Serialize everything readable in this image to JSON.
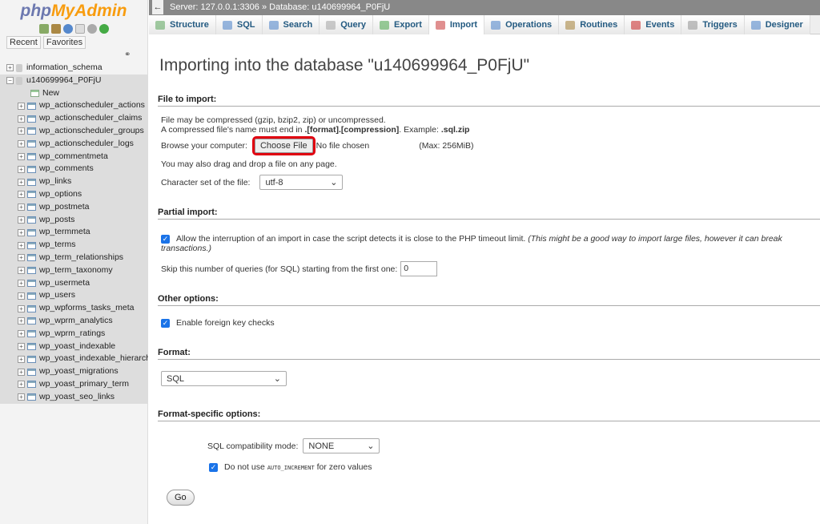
{
  "sidebar": {
    "logo_a": "php",
    "logo_b": "MyAdmin",
    "recent": "Recent",
    "favorites": "Favorites",
    "databases": [
      {
        "name": "information_schema"
      },
      {
        "name": "u140699964_P0FjU"
      }
    ],
    "new_label": "New",
    "tables": [
      "wp_actionscheduler_actions",
      "wp_actionscheduler_claims",
      "wp_actionscheduler_groups",
      "wp_actionscheduler_logs",
      "wp_commentmeta",
      "wp_comments",
      "wp_links",
      "wp_options",
      "wp_postmeta",
      "wp_posts",
      "wp_termmeta",
      "wp_terms",
      "wp_term_relationships",
      "wp_term_taxonomy",
      "wp_usermeta",
      "wp_users",
      "wp_wpforms_tasks_meta",
      "wp_wprm_analytics",
      "wp_wprm_ratings",
      "wp_yoast_indexable",
      "wp_yoast_indexable_hierarchy",
      "wp_yoast_migrations",
      "wp_yoast_primary_term",
      "wp_yoast_seo_links"
    ]
  },
  "breadcrumb": {
    "server": "Server: 127.0.0.1:3306",
    "sep": "»",
    "database": "Database: u140699964_P0FjU"
  },
  "tabs": [
    "Structure",
    "SQL",
    "Search",
    "Query",
    "Export",
    "Import",
    "Operations",
    "Routines",
    "Events",
    "Triggers",
    "Designer"
  ],
  "main": {
    "title": "Importing into the database \"u140699964_P0FjU\"",
    "file_section": "File to import:",
    "compress_note": "File may be compressed (gzip, bzip2, zip) or uncompressed.",
    "compress_note2a": "A compressed file's name must end in ",
    "compress_note2b": ".[format].[compression]",
    "compress_note2c": ". Example: ",
    "compress_note2d": ".sql.zip",
    "browse_label": "Browse your computer:",
    "choose_file": "Choose File",
    "no_file": "No file chosen",
    "max": "(Max: 256MiB)",
    "drag_note": "You may also drag and drop a file on any page.",
    "charset_label": "Character set of the file:",
    "charset": "utf-8",
    "partial_section": "Partial import:",
    "allow_interrupt": "Allow the interruption of an import in case the script detects it is close to the PHP timeout limit.",
    "allow_interrupt_note": "(This might be a good way to import large files, however it can break transactions.)",
    "skip_label": "Skip this number of queries (for SQL) starting from the first one:",
    "skip_value": "0",
    "other_section": "Other options:",
    "fk_checks": "Enable foreign key checks",
    "format_section": "Format:",
    "format": "SQL",
    "format_specific_section": "Format-specific options:",
    "compat_label": "SQL compatibility mode:",
    "compat": "NONE",
    "autoinc_a": "Do not use ",
    "autoinc_b": "AUTO_INCREMENT",
    "autoinc_c": " for zero values",
    "go": "Go"
  }
}
